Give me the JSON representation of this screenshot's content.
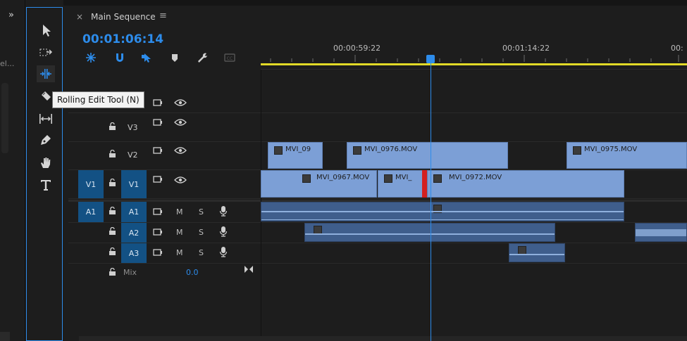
{
  "left_panel": {
    "expand_glyph": "»",
    "clipped_label": "el..."
  },
  "tools": [
    {
      "name": "selection-tool",
      "icon": "arrow-icon"
    },
    {
      "name": "track-select-tool",
      "icon": "track-select-icon"
    },
    {
      "name": "rolling-edit-tool",
      "icon": "rolling-edit-icon"
    },
    {
      "name": "razor-tool",
      "icon": "razor-icon"
    },
    {
      "name": "slip-tool",
      "icon": "slip-icon"
    },
    {
      "name": "pen-tool",
      "icon": "pen-icon"
    },
    {
      "name": "hand-tool",
      "icon": "hand-icon"
    },
    {
      "name": "type-tool",
      "icon": "type-icon"
    }
  ],
  "tooltip": "Rolling Edit Tool (N)",
  "timeline": {
    "close_glyph": "×",
    "title": "Main Sequence",
    "menu_glyph": "≡",
    "timecode": "00:01:06:14",
    "ruler_labels": [
      "00:00:59:22",
      "00:01:14:22",
      "00:"
    ],
    "accent_color": "#2d8ceb",
    "work_area_color": "#e2da27"
  },
  "tracks": {
    "video": [
      {
        "id": "V4",
        "name": ""
      },
      {
        "id": "V3",
        "name": "V3"
      },
      {
        "id": "V2",
        "name": "V2"
      },
      {
        "id": "V1",
        "name": "V1",
        "source": "V1"
      }
    ],
    "audio": [
      {
        "id": "A1",
        "name": "A1",
        "source": "A1",
        "m": "M",
        "s": "S"
      },
      {
        "id": "A2",
        "name": "A2",
        "m": "M",
        "s": "S"
      },
      {
        "id": "A3",
        "name": "A3",
        "m": "M",
        "s": "S"
      }
    ],
    "mix": {
      "label": "Mix",
      "value": "0.0"
    }
  },
  "clips": {
    "v2": [
      "MVI_09",
      "MVI_0976.MOV",
      "MVI_0975.MOV"
    ],
    "v1": [
      "MVI_0967.MOV",
      "MVI_",
      "MVI_0972.MOV"
    ]
  }
}
